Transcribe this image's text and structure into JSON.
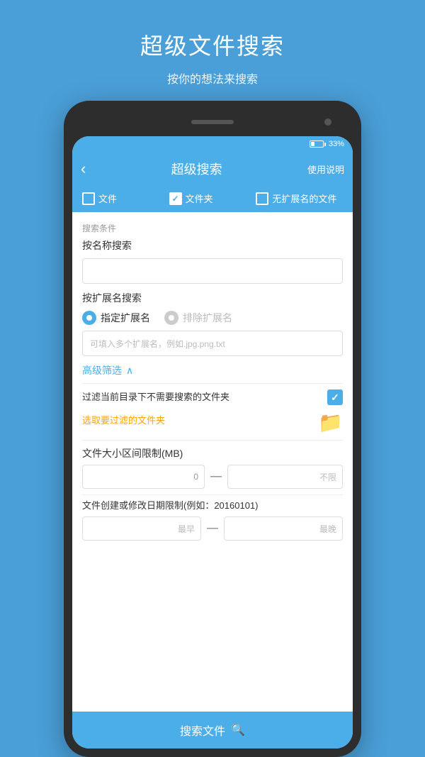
{
  "page": {
    "bg_title": "超级文件搜索",
    "bg_subtitle": "按你的想法来搜索"
  },
  "status_bar": {
    "battery_percent": "33%"
  },
  "app_bar": {
    "title": "超级搜索",
    "back_icon": "‹",
    "help_label": "使用说明"
  },
  "filter_types": [
    {
      "label": "文件",
      "checked": false
    },
    {
      "label": "文件夹",
      "checked": true
    },
    {
      "label": "无扩展名的文件",
      "checked": false
    }
  ],
  "search_conditions": {
    "section_label": "搜索条件",
    "name_search_label": "按名称搜索",
    "name_input_placeholder": "",
    "ext_search_label": "按扩展名搜索",
    "ext_radio": [
      {
        "label": "指定扩展名",
        "active": true
      },
      {
        "label": "排除扩展名",
        "active": false
      }
    ],
    "ext_input_placeholder": "可填入多个扩展名，例如.jpg.png.txt"
  },
  "advanced": {
    "toggle_label": "高级筛选",
    "chevron": "∧",
    "filter_folder_text": "过滤当前目录下不需要搜索的文件夹",
    "select_folder_label": "选取要过滤的文件夹",
    "size_label": "文件大小区间限制(MB)",
    "size_from_placeholder": "0",
    "size_to_placeholder": "不限",
    "date_label": "文件创建或修改日期限制(例如：20160101)",
    "date_from_placeholder": "最早",
    "date_to_placeholder": "最晚"
  },
  "search_button": {
    "label": "搜索文件",
    "icon": "🔍"
  }
}
